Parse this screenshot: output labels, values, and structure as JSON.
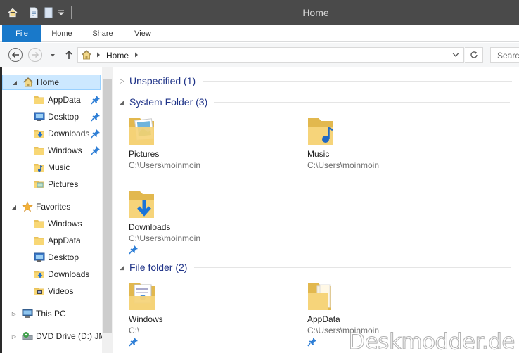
{
  "window": {
    "title": "Home"
  },
  "ribbon": {
    "tabs": [
      "File",
      "Home",
      "Share",
      "View"
    ]
  },
  "address": {
    "path": "Home",
    "search_placeholder": "Search"
  },
  "nav": {
    "home": "Home",
    "home_items": [
      "AppData",
      "Desktop",
      "Downloads",
      "Windows",
      "Music",
      "Pictures"
    ],
    "favorites": "Favorites",
    "favorites_items": [
      "Windows",
      "AppData",
      "Desktop",
      "Downloads",
      "Videos"
    ],
    "thispc": "This PC",
    "dvd": "DVD Drive (D:) JM"
  },
  "content": {
    "groups": [
      {
        "label": "Unspecified (1)"
      },
      {
        "label": "System Folder (3)"
      },
      {
        "label": "File folder (2)"
      }
    ],
    "tiles": [
      {
        "name": "Pictures",
        "path": "C:\\Users\\moinmoin"
      },
      {
        "name": "Music",
        "path": "C:\\Users\\moinmoin"
      },
      {
        "name": "Downloads",
        "path": "C:\\Users\\moinmoin"
      },
      {
        "name": "Windows",
        "path": "C:\\"
      },
      {
        "name": "AppData",
        "path": "C:\\Users\\moinmoin"
      }
    ]
  },
  "watermark": "Deskmodder.de",
  "colors": {
    "file_tab": "#1979ca",
    "selection": "#cce8ff",
    "group_text": "#1e3287",
    "titlebar": "#4a4a4a"
  }
}
